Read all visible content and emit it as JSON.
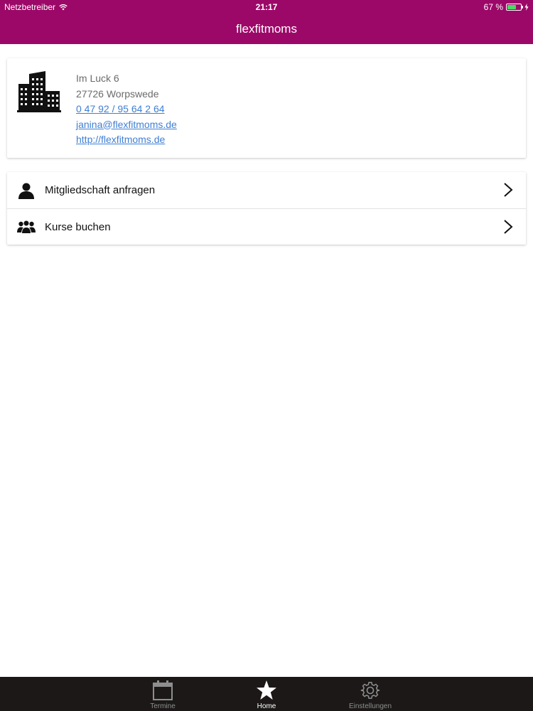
{
  "status_bar": {
    "carrier": "Netzbetreiber",
    "time": "21:17",
    "battery_text": "67 %",
    "battery_level": 0.67
  },
  "nav": {
    "title": "flexfitmoms"
  },
  "contact": {
    "icon": "building-icon",
    "street": "Im Luck 6",
    "city": "27726 Worpswede",
    "phone": "0 47 92 / 95 64 2 64",
    "email": "janina@flexfitmoms.de",
    "website": "http://flexfitmoms.de"
  },
  "menu": [
    {
      "icon": "person-icon",
      "label": "Mitgliedschaft anfragen"
    },
    {
      "icon": "group-icon",
      "label": "Kurse buchen"
    }
  ],
  "tabs": [
    {
      "icon": "calendar-icon",
      "label": "Termine",
      "active": false
    },
    {
      "icon": "star-icon",
      "label": "Home",
      "active": true
    },
    {
      "icon": "gear-icon",
      "label": "Einstellungen",
      "active": false
    }
  ],
  "colors": {
    "brand": "#9c0868",
    "link": "#3f7fd4",
    "tabbar": "#1c1818",
    "battery": "#4cd964"
  }
}
